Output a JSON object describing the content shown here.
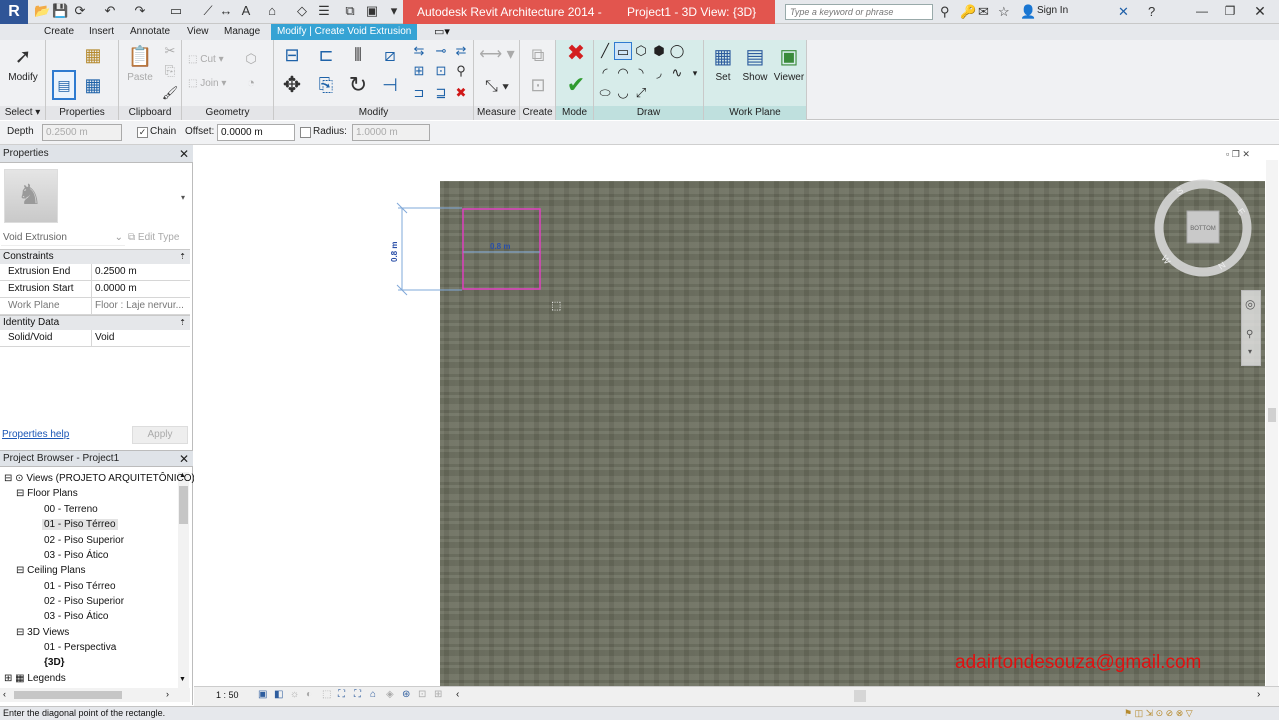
{
  "title_bar": {
    "app_title": "Autodesk Revit Architecture 2014 -",
    "view_title": "Project1 - 3D View: {3D}",
    "search_placeholder": "Type a keyword or phrase",
    "sign_in": "Sign In",
    "app_button": "R"
  },
  "tabs": [
    "Create",
    "Insert",
    "Annotate",
    "View",
    "Manage",
    "Modify | Create Void Extrusion"
  ],
  "ribbon": {
    "select": {
      "button": "Modify",
      "label": "Select"
    },
    "properties": {
      "label": "Properties"
    },
    "clipboard": {
      "paste": "Paste",
      "label": "Clipboard"
    },
    "geometry": {
      "cut": "Cut",
      "join": "Join",
      "label": "Geometry"
    },
    "modify": {
      "label": "Modify"
    },
    "measure": {
      "label": "Measure"
    },
    "create": {
      "label": "Create"
    },
    "mode": {
      "label": "Mode"
    },
    "draw": {
      "label": "Draw"
    },
    "work_plane": {
      "set": "Set",
      "show": "Show",
      "viewer": "Viewer",
      "label": "Work Plane"
    }
  },
  "options_bar": {
    "depth_label": "Depth",
    "depth_value": "0.2500 m",
    "chain_label": "Chain",
    "offset_label": "Offset:",
    "offset_value": "0.0000 m",
    "radius_label": "Radius:",
    "radius_value": "1.0000 m"
  },
  "properties": {
    "title": "Properties",
    "type_name": "Void Extrusion",
    "edit_type": "Edit Type",
    "groups": [
      {
        "name": "Constraints",
        "rows": [
          {
            "key": "Extrusion End",
            "value": "0.2500 m"
          },
          {
            "key": "Extrusion Start",
            "value": "0.0000 m"
          },
          {
            "key": "Work Plane",
            "value": "Floor : Laje nervur..."
          }
        ]
      },
      {
        "name": "Identity Data",
        "rows": [
          {
            "key": "Solid/Void",
            "value": "Void"
          }
        ]
      }
    ],
    "help_link": "Properties help",
    "apply": "Apply"
  },
  "project_browser": {
    "title": "Project Browser - Project1",
    "root": "Views (PROJETO ARQUITETÔNICO)",
    "floor_plans": "Floor Plans",
    "fp_items": [
      "00 - Terreno",
      "01 - Piso Térreo",
      "02 - Piso Superior",
      "03 - Piso Ático"
    ],
    "ceiling_plans": "Ceiling Plans",
    "cp_items": [
      "01 - Piso Térreo",
      "02 - Piso Superior",
      "03 - Piso Ático"
    ],
    "views_3d": "3D Views",
    "v3_items": [
      "01 - Perspectiva",
      "{3D}"
    ],
    "legends": "Legends"
  },
  "canvas": {
    "dim_vertical": "0.8 m",
    "dim_horizontal": "0.8 m",
    "viewcube_face": "BOTTOM",
    "compass_s": "S",
    "compass_e": "E",
    "compass_n": "N",
    "compass_w": "W",
    "watermark": "adairtondesouza@gmail.com"
  },
  "view_control": {
    "scale": "1 : 50"
  },
  "status_bar": {
    "message": "Enter the diagonal point of the rectangle."
  },
  "colors": {
    "ribbon_tab_active": "#36a3d4",
    "title_red": "#e2554e",
    "sketch": "#e040c0",
    "watermark": "#e01010"
  }
}
